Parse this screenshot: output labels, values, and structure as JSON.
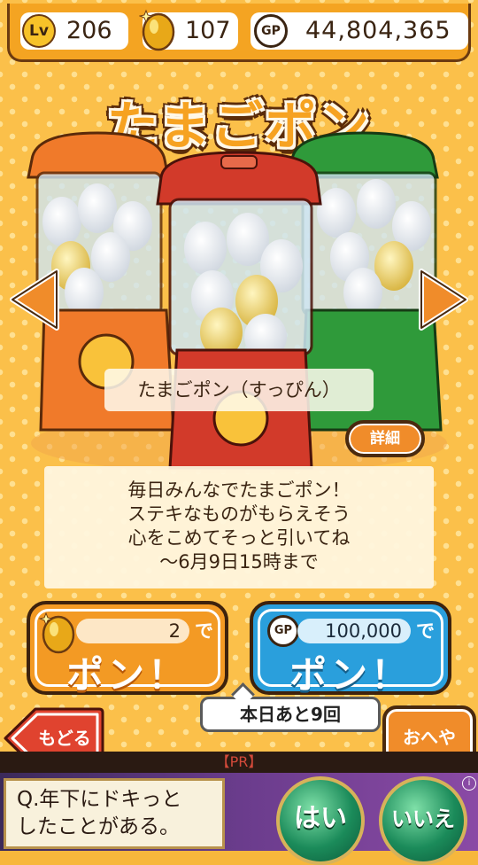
{
  "status": {
    "level_label": "Lv",
    "level": "206",
    "eggs": "107",
    "gp_label": "GP",
    "gp": "44,804,365"
  },
  "title": "たまごポン",
  "machine_label": "たまごポン（すっぴん）",
  "detail_button": "詳細",
  "description": [
    "毎日みんなでたまごポン！",
    "ステキなものがもらえそう",
    "心をこめてそっと引いてね",
    "〜6月9日15時まで"
  ],
  "pon_egg": {
    "cost": "2",
    "suffix": "で",
    "label": "ポン！"
  },
  "pon_gp": {
    "currency": "GP",
    "cost": "100,000",
    "suffix": "で",
    "label": "ポン！"
  },
  "remaining": "本日あと9回",
  "back_button": "もどる",
  "room_button": "おへや",
  "ad": {
    "pr_label": "【PR】",
    "question_line1": "Q.年下にドキっと",
    "question_line2": "したことがある。",
    "yes": "はい",
    "no": "いいえ",
    "info_icon": "i"
  },
  "colors": {
    "orange_machine": "#f07a2a",
    "red_machine": "#d23a2a",
    "green_machine": "#2f9a3a",
    "pon_orange": "#f39a24",
    "pon_blue": "#2a9fdc"
  }
}
